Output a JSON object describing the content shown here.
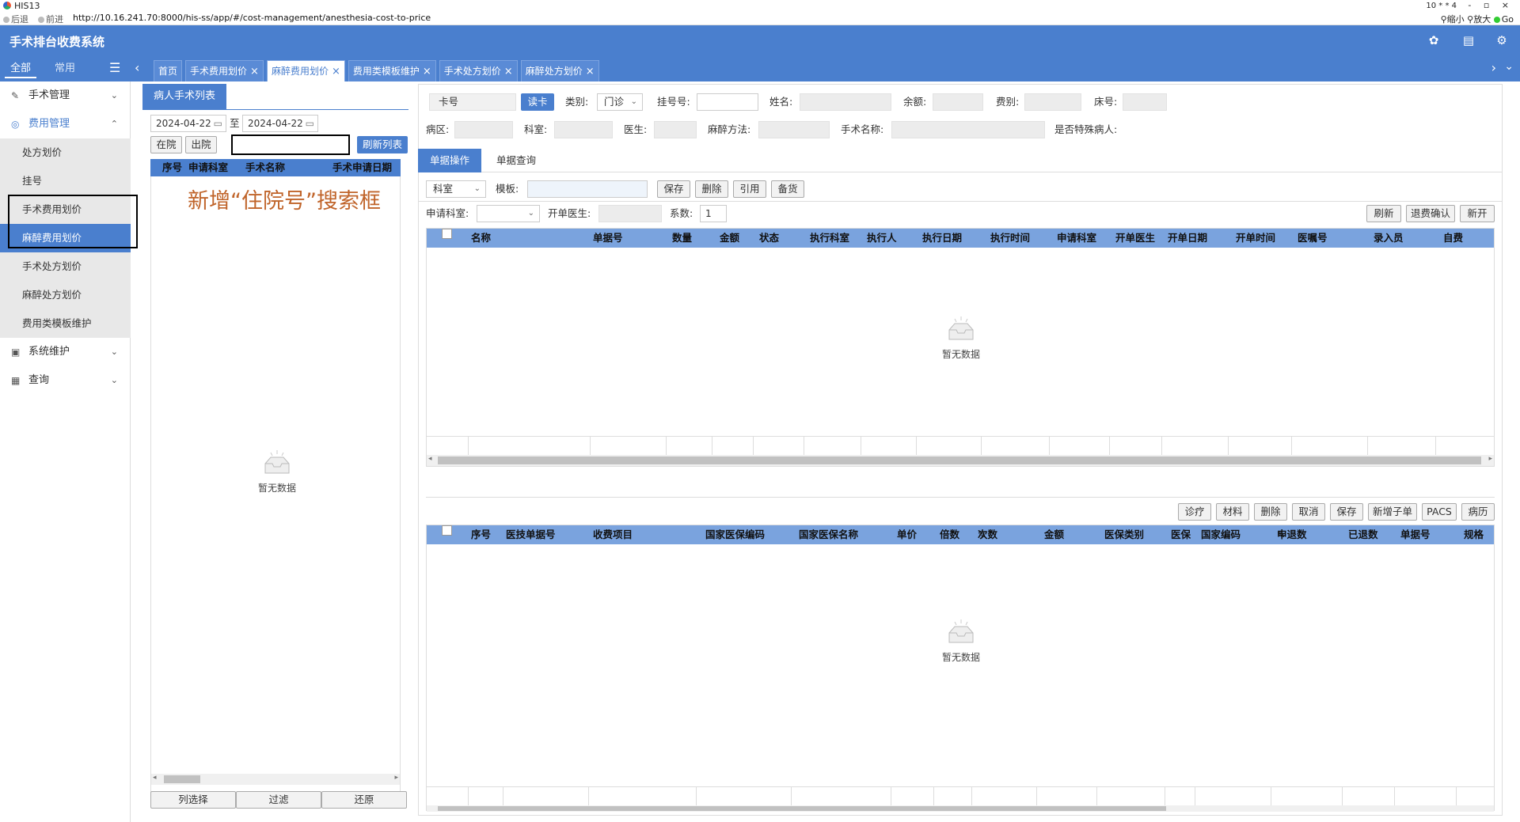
{
  "browser": {
    "window_title": "HIS13",
    "window_counter": "10 * * 4",
    "window_controls": "- ▫ ×",
    "back": "后退",
    "forward": "前进",
    "url": "http://10.16.241.70:8000/his-ss/app/#/cost-management/anesthesia-cost-to-price",
    "zoom_out": "缩小",
    "zoom_in": "放大",
    "go": "Go"
  },
  "app": {
    "title": "手术排台收费系统"
  },
  "sidebar": {
    "tab_all": "全部",
    "tab_common": "常用",
    "menus": [
      {
        "label": "手术管理"
      },
      {
        "label": "费用管理"
      },
      {
        "label": "系统维护"
      },
      {
        "label": "查询"
      }
    ],
    "sub_items": [
      {
        "label": "处方划价"
      },
      {
        "label": "挂号"
      },
      {
        "label": "手术费用划价"
      },
      {
        "label": "麻醉费用划价"
      },
      {
        "label": "手术处方划价"
      },
      {
        "label": "麻醉处方划价"
      },
      {
        "label": "费用类模板维护"
      }
    ]
  },
  "tabs": [
    {
      "label": "首页",
      "closable": false
    },
    {
      "label": "手术费用划价",
      "closable": true
    },
    {
      "label": "麻醉费用划价",
      "closable": true
    },
    {
      "label": "费用类模板维护",
      "closable": true
    },
    {
      "label": "手术处方划价",
      "closable": true
    },
    {
      "label": "麻醉处方划价",
      "closable": true
    }
  ],
  "patient_panel": {
    "title": "病人手术列表",
    "date_from": "2024-04-22",
    "date_to_label": "至",
    "date_to": "2024-04-22",
    "btn_in": "在院",
    "btn_out": "出院",
    "search_value": "",
    "btn_refresh": "刷新列表",
    "columns": [
      "序号",
      "申请科室",
      "手术名称",
      "手术申请日期"
    ],
    "annotation": "新增“住院号”搜索框",
    "empty_text": "暂无数据",
    "footer_buttons": [
      "列选择",
      "过滤",
      "还原"
    ]
  },
  "patient_info": {
    "card_label": "卡号",
    "read_card": "读卡",
    "category_label": "类别:",
    "category_value": "门诊",
    "reg_label": "挂号号:",
    "name_label": "姓名:",
    "balance_label": "余额:",
    "fee_type_label": "费别:",
    "bed_label": "床号:",
    "ward_label": "病区:",
    "dept_label": "科室:",
    "doctor_label": "医生:",
    "anesthesia_label": "麻醉方法:",
    "surgery_label": "手术名称:",
    "special_label": "是否特殊病人:"
  },
  "sub_tabs": [
    "单据操作",
    "单据查询"
  ],
  "toolbar": {
    "dept_select": "科室",
    "template_label": "模板:",
    "save": "保存",
    "delete": "删除",
    "quote": "引用",
    "stock": "备货",
    "apply_dept_label": "申请科室:",
    "doctor_label": "开单医生:",
    "coef_label": "系数:",
    "coef_value": "1",
    "refresh": "刷新",
    "refund_confirm": "退费确认",
    "new": "新开"
  },
  "grid1": {
    "columns": [
      "名称",
      "单据号",
      "数量",
      "金额",
      "状态",
      "执行科室",
      "执行人",
      "执行日期",
      "执行时间",
      "申请科室",
      "开单医生",
      "开单日期",
      "开单时间",
      "医嘱号",
      "录入员",
      "自费"
    ],
    "empty_text": "暂无数据"
  },
  "grid2_toolbar": [
    "诊疗",
    "材料",
    "删除",
    "取消",
    "保存",
    "新增子单",
    "PACS",
    "病历"
  ],
  "grid2": {
    "columns": [
      "序号",
      "医技单据号",
      "收费项目",
      "国家医保编码",
      "国家医保名称",
      "单价",
      "倍数",
      "次数",
      "金额",
      "医保类别",
      "医保",
      "国家编码",
      "申退数",
      "已退数",
      "单据号",
      "规格"
    ],
    "empty_text": "暂无数据"
  },
  "colors": {
    "primary": "#4a7fce",
    "header_row": "#7aa3de",
    "annotation": "#c0642a"
  }
}
